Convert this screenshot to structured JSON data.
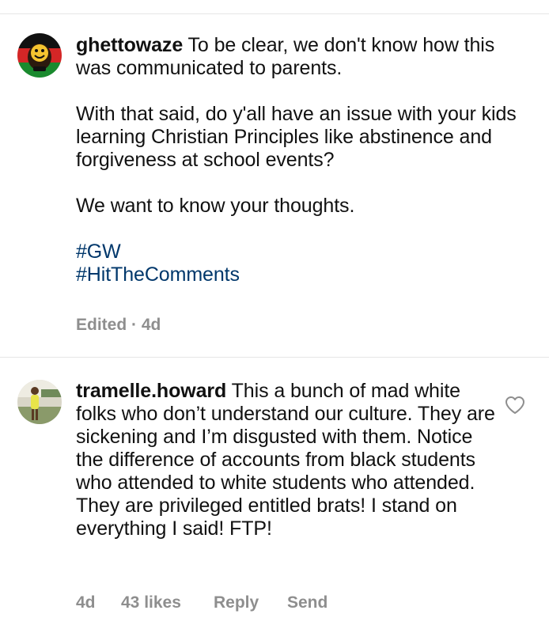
{
  "comments": [
    {
      "username": "ghettowaze",
      "paragraphs": [
        "To be clear, we don't know how this was communicated to parents.",
        "With that said, do y'all have an issue with your kids learning Christian Principles like abstinence and forgiveness at school events?",
        "We want to know your thoughts."
      ],
      "hashtags": [
        "#GW",
        "#HitTheComments"
      ],
      "meta": "Edited · 4d"
    },
    {
      "username": "tramelle.howard",
      "text": "This a bunch of mad white folks who don’t understand our culture. They are sickening and I’m disgusted with them. Notice the difference of accounts from black students who attended to white students who attended. They are privileged entitled brats! I stand on everything I said! FTP!",
      "time": "4d",
      "likes": "43 likes",
      "reply": "Reply",
      "send": "Send"
    }
  ],
  "icons": {
    "like": "heart-outline-icon"
  },
  "colors": {
    "hashtag": "#00376b",
    "meta": "#8e8e8e",
    "divider": "#e6e6e6"
  }
}
